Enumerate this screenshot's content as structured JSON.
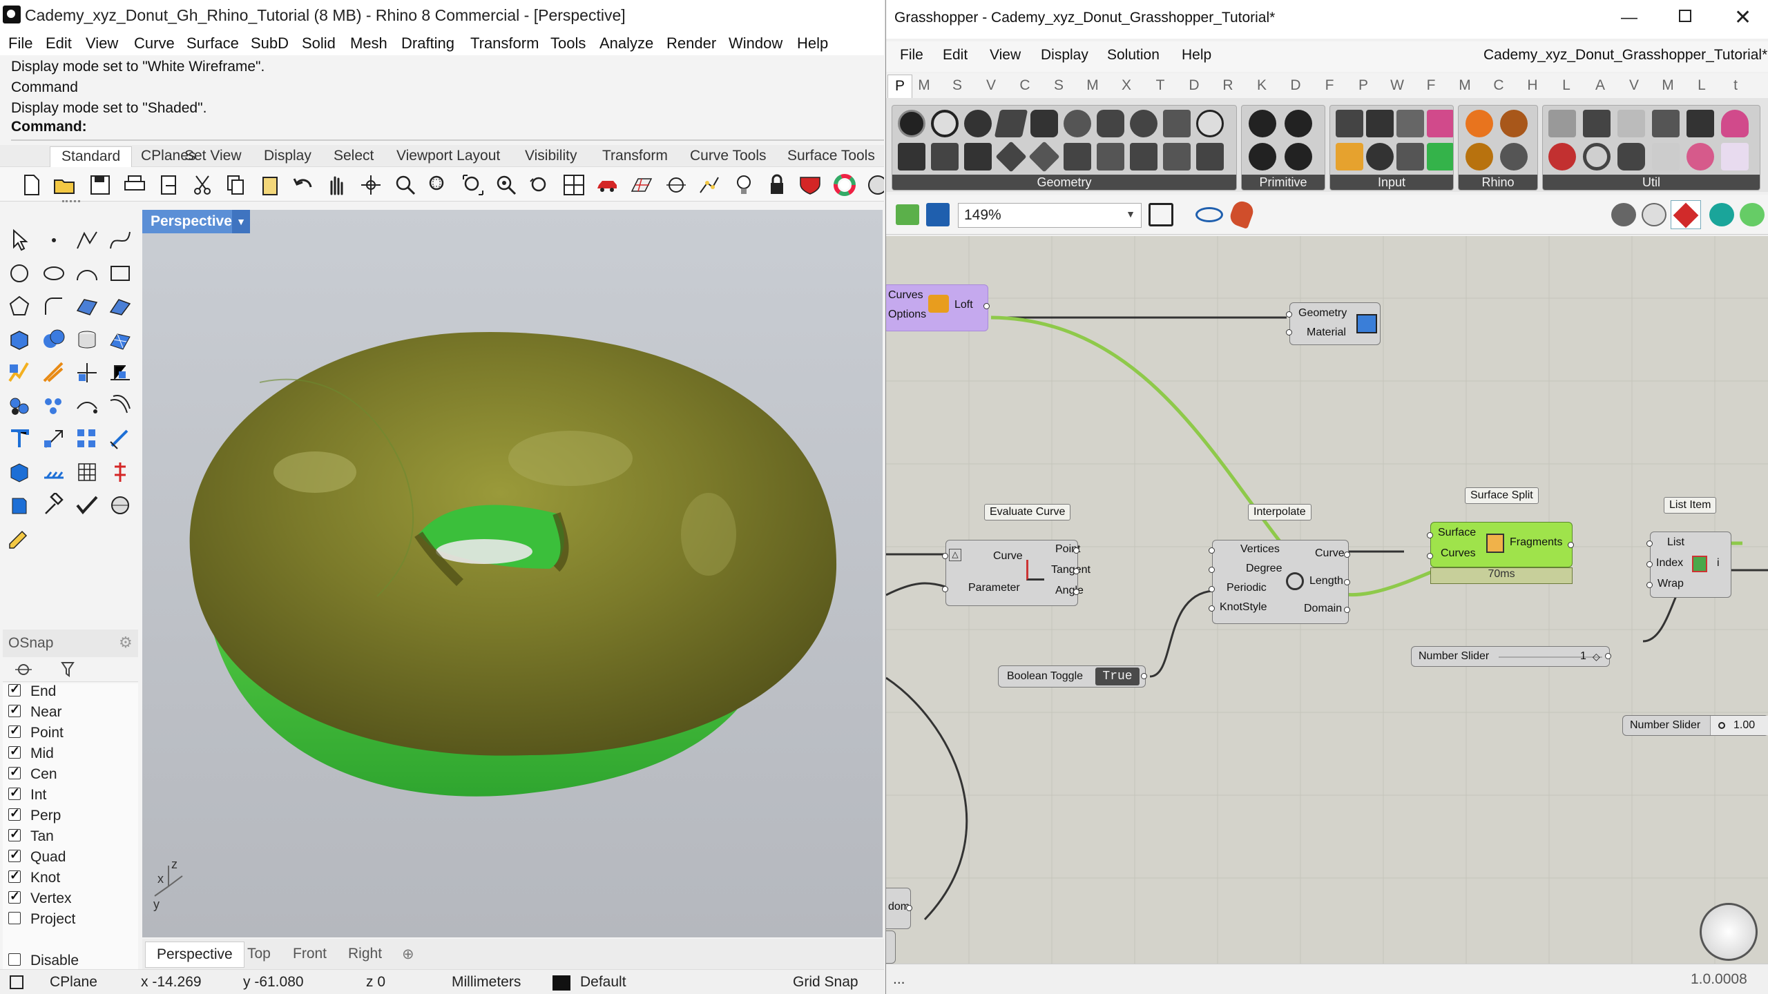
{
  "rhino": {
    "title": "Cademy_xyz_Donut_Gh_Rhino_Tutorial (8 MB) - Rhino 8 Commercial - [Perspective]",
    "menu": [
      "File",
      "Edit",
      "View",
      "Curve",
      "Surface",
      "SubD",
      "Solid",
      "Mesh",
      "Drafting",
      "Transform",
      "Tools",
      "Analyze",
      "Render",
      "Window",
      "Help"
    ],
    "history": [
      "Display mode set to \"White Wireframe\".",
      "Command",
      "Display mode set to \"Shaded\"."
    ],
    "command_prompt": "Command:",
    "toolbar_tabs": [
      "Standard",
      "CPlanes",
      "Set View",
      "Display",
      "Select",
      "Viewport Layout",
      "Visibility",
      "Transform",
      "Curve Tools",
      "Surface Tools"
    ],
    "viewport": {
      "label": "Perspective",
      "axis_x": "x",
      "axis_y": "y",
      "axis_z": "z",
      "tabs": [
        "Perspective",
        "Top",
        "Front",
        "Right"
      ]
    },
    "osnap": {
      "title": "OSnap",
      "items": [
        {
          "label": "End",
          "checked": true
        },
        {
          "label": "Near",
          "checked": true
        },
        {
          "label": "Point",
          "checked": true
        },
        {
          "label": "Mid",
          "checked": true
        },
        {
          "label": "Cen",
          "checked": true
        },
        {
          "label": "Int",
          "checked": true
        },
        {
          "label": "Perp",
          "checked": true
        },
        {
          "label": "Tan",
          "checked": true
        },
        {
          "label": "Quad",
          "checked": true
        },
        {
          "label": "Knot",
          "checked": true
        },
        {
          "label": "Vertex",
          "checked": true
        },
        {
          "label": "Project",
          "checked": false
        }
      ],
      "disable_label": "Disable"
    },
    "status": {
      "cplane": "CPlane",
      "x": "x -14.269",
      "y": "y -61.080",
      "z": "z 0",
      "units": "Millimeters",
      "layer": "Default",
      "grid_snap": "Grid Snap"
    },
    "colors": {
      "donut_top": "#6b6a21",
      "donut_inner": "#3fbf3f",
      "viewport_label": "#5b8fd6"
    }
  },
  "grasshopper": {
    "title": "Grasshopper - Cademy_xyz_Donut_Grasshopper_Tutorial*",
    "doc_name": "Cademy_xyz_Donut_Grasshopper_Tutorial*",
    "menu": [
      "File",
      "Edit",
      "View",
      "Display",
      "Solution",
      "Help"
    ],
    "categories": [
      "P",
      "M",
      "S",
      "V",
      "C",
      "S",
      "M",
      "X",
      "T",
      "D",
      "R",
      "K",
      "D",
      "F",
      "P",
      "W",
      "F",
      "M",
      "C",
      "H",
      "L",
      "A",
      "V",
      "M",
      "L",
      "t"
    ],
    "ribbon_groups": [
      "Geometry",
      "Primitive",
      "Input",
      "Rhino",
      "Util"
    ],
    "zoom": "149%",
    "status_text": "...",
    "version": "1.0.0008",
    "nodes": {
      "loft": {
        "in1": "Curves",
        "in2": "Options",
        "name": "Loft"
      },
      "preview": {
        "in1": "Geometry",
        "in2": "Material"
      },
      "evaluate_curve": {
        "label": "Evaluate Curve",
        "in1": "Curve",
        "in2": "Parameter",
        "out1": "Point",
        "out2": "Tangent",
        "out3": "Angle"
      },
      "interpolate": {
        "label": "Interpolate",
        "in1": "Vertices",
        "in2": "Degree",
        "in3": "Periodic",
        "in4": "KnotStyle",
        "out1": "Curve",
        "out2": "Length",
        "out3": "Domain"
      },
      "surface_split": {
        "label": "Surface Split",
        "in1": "Surface",
        "in2": "Curves",
        "out1": "Fragments",
        "time": "70ms"
      },
      "list_item": {
        "label": "List Item",
        "in1": "List",
        "in2": "Index",
        "in3": "Wrap",
        "out1": "i"
      },
      "boolean_toggle": {
        "name": "Boolean Toggle",
        "value": "True"
      },
      "slider1": {
        "name": "Number Slider",
        "value": "1"
      },
      "slider2": {
        "name": "Number Slider",
        "value": "1.00"
      },
      "domain_fragment": "dom"
    }
  }
}
